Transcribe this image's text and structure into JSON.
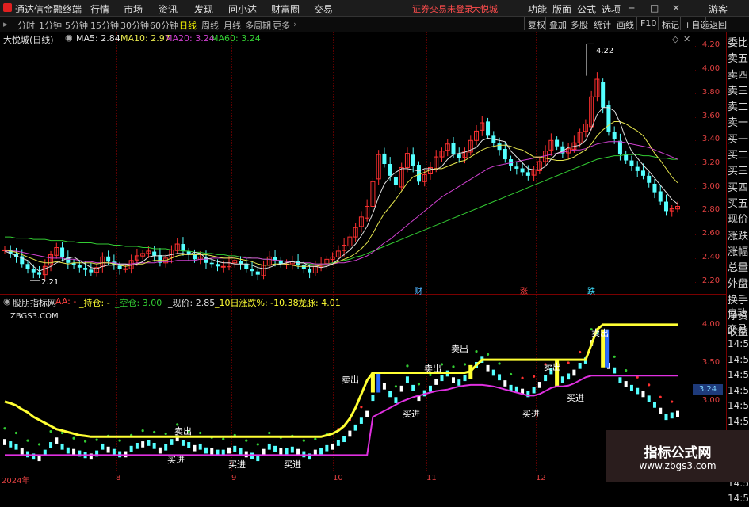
{
  "app": {
    "title": "通达信金融终端",
    "menu": [
      "行情",
      "市场",
      "资讯",
      "发现",
      "问小达",
      "财富圈",
      "交易"
    ],
    "login_warning": "证券交易未登录",
    "stock_name": "大悦城",
    "right_menu": [
      "功能",
      "版面",
      "公式",
      "选项"
    ],
    "guest": "游客"
  },
  "toolbar": {
    "periods": [
      "分时",
      "1分钟",
      "5分钟",
      "15分钟",
      "30分钟",
      "60分钟",
      "日线",
      "周线",
      "月线",
      "多周期",
      "更多"
    ],
    "active_period": "日线",
    "tools": [
      "复权",
      "叠加",
      "多股",
      "统计",
      "画线",
      "F10",
      "标记",
      "+自选",
      "返回"
    ]
  },
  "price_pane": {
    "title": "大悦城(日线)",
    "ma": [
      {
        "label": "MA5: 2.84",
        "color": "#e0e0e0"
      },
      {
        "label": "MA10: 2.97",
        "color": "#e6e64d"
      },
      {
        "label": "MA20: 3.24",
        "color": "#d040d0"
      },
      {
        "label": "MA60: 3.24",
        "color": "#33cc33"
      }
    ],
    "y_ticks": [
      "4.20",
      "4.00",
      "3.80",
      "3.60",
      "3.40",
      "3.20",
      "3.00",
      "2.80",
      "2.60",
      "2.40",
      "2.20"
    ],
    "high_label": "4.22",
    "low_label": "2.21",
    "markers": [
      {
        "text": "财",
        "color": "#4fb4ff"
      },
      {
        "text": "涨",
        "color": "#ff4040"
      },
      {
        "text": "跌",
        "color": "#40e0ff"
      }
    ],
    "side": [
      "委比",
      "卖五",
      "卖四",
      "卖三",
      "卖二",
      "卖一",
      "买一",
      "买二",
      "买三",
      "买四",
      "买五",
      "现价",
      "涨跌",
      "涨幅",
      "总量",
      "外盘",
      "换手",
      "净资",
      "收益"
    ]
  },
  "indicator_pane": {
    "title": "股朋指标网",
    "aa_label": "AA: -",
    "hold_label": "_持仓: -",
    "empty_label": "_空仓: 3.00",
    "price_label": "_现价: 2.85",
    "change_label": "_10日涨跌%: -10.38",
    "dragon_label": "龙脉: 4.01",
    "site": "ZBGS3.COM",
    "y_ticks": [
      "4.00",
      "3.50",
      "3.00"
    ],
    "highlight_value": "3.24",
    "signals_buy": [
      "买进",
      "买进",
      "买进",
      "买进",
      "买进",
      "买进"
    ],
    "signals_sell": [
      "卖出",
      "卖出",
      "卖出",
      "卖出",
      "卖出",
      "卖出"
    ],
    "side": [
      "自动",
      "交易",
      "14:56",
      "14:56",
      "14:56",
      "14:56",
      "14:56",
      "14:56",
      "14:56",
      "14:56",
      "14:56",
      "14:56",
      "14:56"
    ]
  },
  "x_axis": [
    "2024年",
    "8",
    "9",
    "10",
    "11",
    "12"
  ],
  "watermark": {
    "title": "指标公式网",
    "url": "www.zbgs3.com"
  },
  "colors": {
    "up": "#ff3030",
    "down": "#54ffff",
    "ma5": "#e0e0e0",
    "ma10": "#e6e64d",
    "ma20": "#d040d0",
    "ma60": "#33cc33",
    "grid": "#7a0000",
    "dragon": "#ffff33"
  },
  "chart_data": [
    {
      "type": "candlestick",
      "title": "大悦城(日线)",
      "ylim": [
        2.15,
        4.25
      ],
      "close": [
        2.47,
        2.44,
        2.41,
        2.35,
        2.31,
        2.28,
        2.26,
        2.33,
        2.43,
        2.49,
        2.41,
        2.36,
        2.34,
        2.32,
        2.3,
        2.28,
        2.32,
        2.41,
        2.37,
        2.34,
        2.31,
        2.31,
        2.38,
        2.42,
        2.44,
        2.46,
        2.42,
        2.36,
        2.4,
        2.47,
        2.52,
        2.46,
        2.43,
        2.39,
        2.41,
        2.36,
        2.35,
        2.33,
        2.33,
        2.36,
        2.38,
        2.35,
        2.31,
        2.29,
        2.26,
        2.34,
        2.41,
        2.38,
        2.35,
        2.35,
        2.37,
        2.34,
        2.31,
        2.28,
        2.33,
        2.35,
        2.39,
        2.41,
        2.46,
        2.51,
        2.58,
        2.66,
        2.75,
        2.84,
        3.05,
        3.28,
        3.2,
        3.1,
        3.02,
        3.17,
        3.29,
        3.18,
        3.05,
        3.11,
        3.17,
        3.26,
        3.31,
        3.37,
        3.28,
        3.25,
        3.31,
        3.4,
        3.48,
        3.55,
        3.44,
        3.38,
        3.32,
        3.24,
        3.18,
        3.16,
        3.13,
        3.1,
        3.15,
        3.22,
        3.31,
        3.4,
        3.35,
        3.29,
        3.33,
        3.38,
        3.47,
        3.54,
        3.77,
        3.92,
        3.68,
        3.47,
        3.41,
        3.28,
        3.23,
        3.18,
        3.14,
        3.1,
        3.04,
        2.96,
        2.88,
        2.8,
        2.82,
        2.84
      ],
      "ma5": [
        2.46,
        2.44,
        2.42,
        2.4,
        2.38,
        2.33,
        2.29,
        2.31,
        2.33,
        2.36,
        2.38,
        2.4,
        2.41,
        2.38,
        2.35,
        2.32,
        2.31,
        2.33,
        2.34,
        2.34,
        2.35,
        2.35,
        2.34,
        2.35,
        2.37,
        2.41,
        2.42,
        2.42,
        2.42,
        2.43,
        2.44,
        2.44,
        2.43,
        2.45,
        2.44,
        2.4,
        2.39,
        2.37,
        2.36,
        2.36,
        2.35,
        2.35,
        2.35,
        2.34,
        2.32,
        2.31,
        2.32,
        2.34,
        2.35,
        2.36,
        2.37,
        2.36,
        2.36,
        2.33,
        2.33,
        2.32,
        2.33,
        2.35,
        2.39,
        2.43,
        2.47,
        2.52,
        2.59,
        2.67,
        2.78,
        2.92,
        3.03,
        3.09,
        3.13,
        3.16,
        3.16,
        3.15,
        3.14,
        3.16,
        3.16,
        3.15,
        3.18,
        3.24,
        3.28,
        3.29,
        3.3,
        3.32,
        3.34,
        3.4,
        3.42,
        3.41,
        3.4,
        3.39,
        3.31,
        3.26,
        3.21,
        3.16,
        3.15,
        3.15,
        3.18,
        3.24,
        3.29,
        3.31,
        3.34,
        3.35,
        3.36,
        3.4,
        3.5,
        3.62,
        3.68,
        3.68,
        3.65,
        3.55,
        3.41,
        3.31,
        3.25,
        3.19,
        3.14,
        3.08,
        3.02,
        2.96,
        2.9,
        2.86
      ],
      "ma10": [
        2.47,
        2.46,
        2.45,
        2.43,
        2.41,
        2.39,
        2.37,
        2.36,
        2.36,
        2.37,
        2.36,
        2.35,
        2.36,
        2.36,
        2.36,
        2.36,
        2.35,
        2.36,
        2.36,
        2.35,
        2.34,
        2.33,
        2.34,
        2.35,
        2.35,
        2.37,
        2.38,
        2.38,
        2.38,
        2.4,
        2.42,
        2.43,
        2.43,
        2.43,
        2.43,
        2.43,
        2.42,
        2.41,
        2.4,
        2.4,
        2.4,
        2.39,
        2.38,
        2.37,
        2.35,
        2.34,
        2.34,
        2.35,
        2.35,
        2.35,
        2.34,
        2.33,
        2.33,
        2.33,
        2.33,
        2.34,
        2.34,
        2.35,
        2.37,
        2.39,
        2.41,
        2.44,
        2.48,
        2.53,
        2.61,
        2.7,
        2.78,
        2.84,
        2.9,
        2.97,
        3.04,
        3.09,
        3.11,
        3.13,
        3.15,
        3.16,
        3.16,
        3.18,
        3.2,
        3.22,
        3.23,
        3.26,
        3.29,
        3.32,
        3.34,
        3.35,
        3.36,
        3.36,
        3.35,
        3.33,
        3.32,
        3.29,
        3.26,
        3.26,
        3.25,
        3.24,
        3.23,
        3.23,
        3.24,
        3.26,
        3.29,
        3.32,
        3.37,
        3.44,
        3.49,
        3.53,
        3.56,
        3.56,
        3.54,
        3.51,
        3.48,
        3.44,
        3.37,
        3.29,
        3.23,
        3.16,
        3.09,
        3.04
      ],
      "ma20": [
        2.46,
        2.46,
        2.46,
        2.45,
        2.44,
        2.43,
        2.42,
        2.41,
        2.4,
        2.4,
        2.4,
        2.39,
        2.39,
        2.38,
        2.37,
        2.37,
        2.36,
        2.36,
        2.36,
        2.36,
        2.35,
        2.35,
        2.35,
        2.36,
        2.36,
        2.36,
        2.36,
        2.37,
        2.37,
        2.37,
        2.38,
        2.38,
        2.38,
        2.38,
        2.39,
        2.39,
        2.4,
        2.4,
        2.4,
        2.4,
        2.41,
        2.41,
        2.4,
        2.4,
        2.4,
        2.39,
        2.39,
        2.38,
        2.38,
        2.37,
        2.37,
        2.36,
        2.36,
        2.36,
        2.35,
        2.35,
        2.35,
        2.35,
        2.36,
        2.36,
        2.37,
        2.38,
        2.4,
        2.42,
        2.45,
        2.49,
        2.53,
        2.56,
        2.6,
        2.64,
        2.68,
        2.72,
        2.76,
        2.8,
        2.84,
        2.88,
        2.92,
        2.95,
        2.98,
        3.01,
        3.04,
        3.07,
        3.1,
        3.13,
        3.16,
        3.18,
        3.19,
        3.2,
        3.21,
        3.22,
        3.23,
        3.24,
        3.25,
        3.26,
        3.27,
        3.28,
        3.29,
        3.3,
        3.31,
        3.32,
        3.32,
        3.33,
        3.35,
        3.37,
        3.38,
        3.39,
        3.39,
        3.39,
        3.38,
        3.37,
        3.36,
        3.35,
        3.34,
        3.32,
        3.3,
        3.28,
        3.26,
        3.24
      ],
      "ma60": [
        2.58,
        2.58,
        2.57,
        2.57,
        2.57,
        2.56,
        2.56,
        2.56,
        2.55,
        2.55,
        2.55,
        2.54,
        2.54,
        2.53,
        2.53,
        2.53,
        2.52,
        2.52,
        2.52,
        2.51,
        2.51,
        2.5,
        2.5,
        2.5,
        2.49,
        2.49,
        2.48,
        2.48,
        2.48,
        2.47,
        2.47,
        2.46,
        2.46,
        2.45,
        2.45,
        2.44,
        2.44,
        2.43,
        2.43,
        2.42,
        2.42,
        2.41,
        2.41,
        2.4,
        2.4,
        2.39,
        2.39,
        2.38,
        2.38,
        2.37,
        2.37,
        2.36,
        2.36,
        2.35,
        2.35,
        2.35,
        2.35,
        2.36,
        2.37,
        2.38,
        2.39,
        2.41,
        2.42,
        2.44,
        2.46,
        2.48,
        2.5,
        2.52,
        2.54,
        2.56,
        2.58,
        2.6,
        2.62,
        2.64,
        2.66,
        2.68,
        2.7,
        2.72,
        2.74,
        2.76,
        2.78,
        2.8,
        2.82,
        2.84,
        2.86,
        2.88,
        2.9,
        2.92,
        2.94,
        2.96,
        2.98,
        3.0,
        3.02,
        3.04,
        3.06,
        3.08,
        3.1,
        3.12,
        3.14,
        3.16,
        3.18,
        3.2,
        3.22,
        3.24,
        3.25,
        3.26,
        3.27,
        3.27,
        3.28,
        3.28,
        3.28,
        3.27,
        3.27,
        3.26,
        3.25,
        3.25,
        3.24,
        3.24
      ]
    },
    {
      "type": "line",
      "title": "股朋指标网",
      "ylim": [
        2.2,
        4.3
      ],
      "dragon": [
        3.0,
        2.98,
        2.95,
        2.9,
        2.86,
        2.8,
        2.76,
        2.72,
        2.68,
        2.64,
        2.62,
        2.6,
        2.58,
        2.56,
        2.55,
        2.54,
        2.54,
        2.54,
        2.54,
        2.54,
        2.54,
        2.54,
        2.54,
        2.54,
        2.54,
        2.54,
        2.54,
        2.54,
        2.54,
        2.54,
        2.54,
        2.54,
        2.54,
        2.54,
        2.54,
        2.54,
        2.54,
        2.54,
        2.54,
        2.54,
        2.54,
        2.54,
        2.54,
        2.54,
        2.54,
        2.54,
        2.54,
        2.54,
        2.54,
        2.54,
        2.54,
        2.54,
        2.54,
        2.54,
        2.54,
        2.54,
        2.56,
        2.58,
        2.62,
        2.68,
        2.78,
        2.92,
        3.1,
        3.28,
        3.38,
        3.38,
        3.38,
        3.38,
        3.38,
        3.38,
        3.38,
        3.38,
        3.38,
        3.38,
        3.38,
        3.38,
        3.38,
        3.38,
        3.38,
        3.38,
        3.38,
        3.4,
        3.48,
        3.55,
        3.55,
        3.55,
        3.55,
        3.55,
        3.55,
        3.55,
        3.55,
        3.55,
        3.55,
        3.55,
        3.55,
        3.55,
        3.55,
        3.55,
        3.55,
        3.55,
        3.55,
        3.55,
        3.75,
        3.95,
        4.01,
        4.01,
        4.01,
        4.01,
        4.01,
        4.01,
        4.01,
        4.01,
        4.01,
        4.01,
        4.01,
        4.01,
        4.01,
        4.01
      ],
      "trend": [
        2.3,
        2.3,
        2.3,
        2.3,
        2.3,
        2.3,
        2.3,
        2.3,
        2.3,
        2.3,
        2.3,
        2.3,
        2.3,
        2.3,
        2.3,
        2.3,
        2.3,
        2.3,
        2.3,
        2.3,
        2.3,
        2.3,
        2.3,
        2.3,
        2.3,
        2.3,
        2.3,
        2.3,
        2.3,
        2.3,
        2.3,
        2.3,
        2.3,
        2.3,
        2.3,
        2.3,
        2.3,
        2.3,
        2.3,
        2.3,
        2.3,
        2.3,
        2.3,
        2.3,
        2.3,
        2.3,
        2.3,
        2.3,
        2.3,
        2.3,
        2.3,
        2.3,
        2.3,
        2.3,
        2.3,
        2.3,
        2.3,
        2.3,
        2.3,
        2.3,
        2.3,
        2.3,
        2.3,
        2.3,
        2.8,
        2.84,
        2.88,
        2.92,
        2.96,
        3.0,
        3.03,
        3.06,
        3.08,
        3.1,
        3.12,
        3.14,
        3.15,
        3.16,
        3.18,
        3.2,
        3.21,
        3.22,
        3.22,
        3.22,
        3.21,
        3.2,
        3.18,
        3.16,
        3.14,
        3.12,
        3.1,
        3.08,
        3.08,
        3.1,
        3.14,
        3.18,
        3.2,
        3.2,
        3.21,
        3.24,
        3.28,
        3.32,
        3.34,
        3.34,
        3.34,
        3.34,
        3.34,
        3.34,
        3.34,
        3.34,
        3.34,
        3.34,
        3.34,
        3.34,
        3.34,
        3.34,
        3.34,
        3.34
      ]
    }
  ]
}
